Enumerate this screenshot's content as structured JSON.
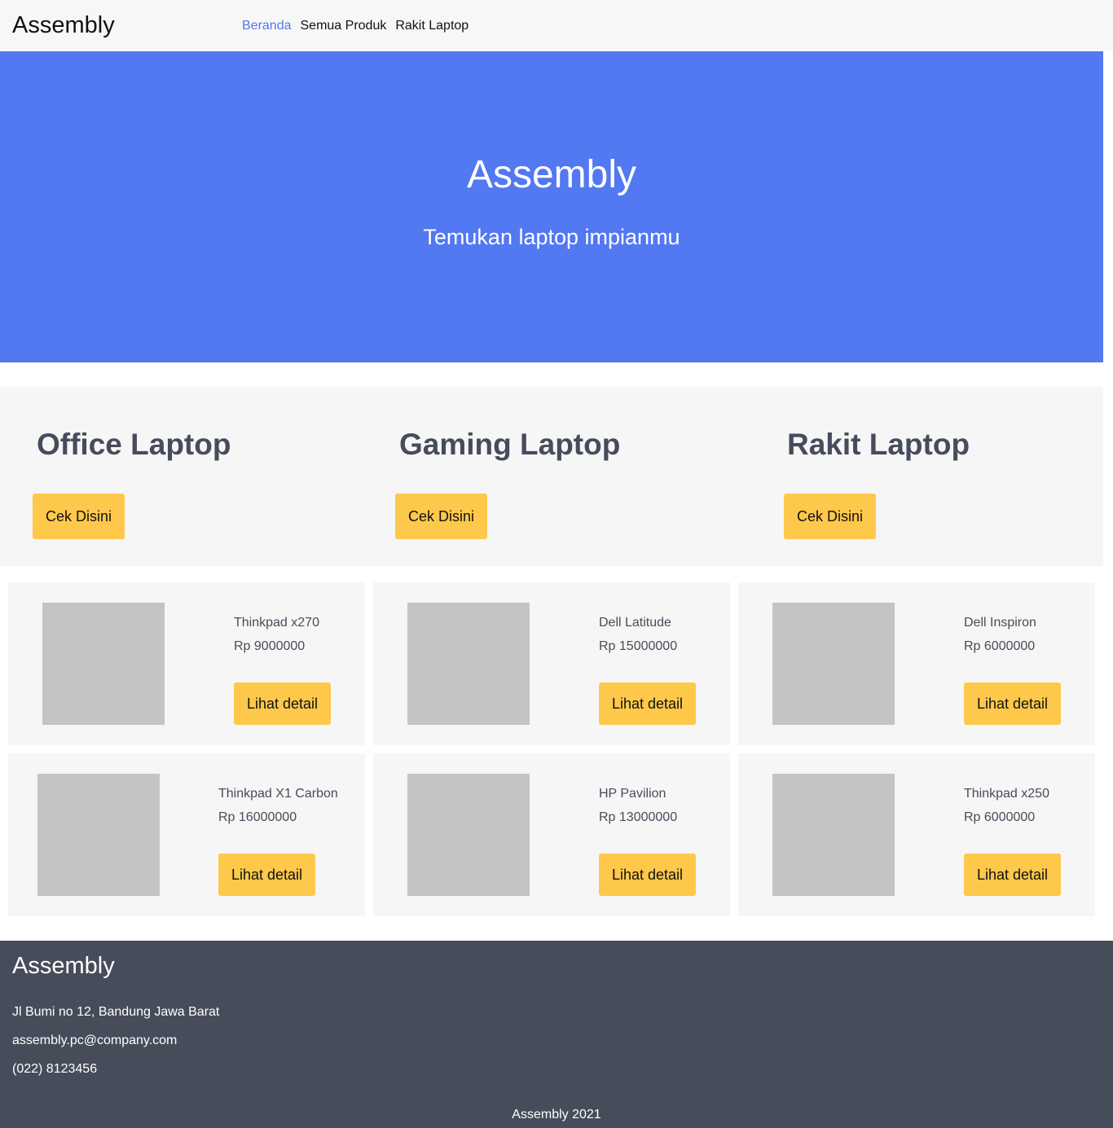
{
  "navbar": {
    "brand": "Assembly",
    "links": [
      {
        "label": "Beranda",
        "active": true
      },
      {
        "label": "Semua Produk",
        "active": false
      },
      {
        "label": "Rakit Laptop",
        "active": false
      }
    ]
  },
  "hero": {
    "title": "Assembly",
    "subtitle": "Temukan laptop impianmu"
  },
  "categories": [
    {
      "title": "Office Laptop",
      "button": "Cek Disini"
    },
    {
      "title": "Gaming Laptop",
      "button": "Cek Disini"
    },
    {
      "title": "Rakit Laptop",
      "button": "Cek Disini"
    }
  ],
  "products": [
    {
      "name": "Thinkpad x270",
      "price": "Rp 9000000",
      "button": "Lihat detail"
    },
    {
      "name": "Dell Latitude",
      "price": "Rp 15000000",
      "button": "Lihat detail"
    },
    {
      "name": "Dell Inspiron",
      "price": "Rp 6000000",
      "button": "Lihat detail"
    },
    {
      "name": "Thinkpad X1 Carbon",
      "price": "Rp 16000000",
      "button": "Lihat detail"
    },
    {
      "name": "HP Pavilion",
      "price": "Rp 13000000",
      "button": "Lihat detail"
    },
    {
      "name": "Thinkpad x250",
      "price": "Rp 6000000",
      "button": "Lihat detail"
    }
  ],
  "footer": {
    "brand": "Assembly",
    "address": "Jl Bumi no 12, Bandung Jawa Barat",
    "email": "assembly.pc@company.com",
    "phone": "(022) 8123456",
    "copyright": "Assembly 2021"
  },
  "colors": {
    "accent": "#5278f2",
    "button": "#fec84a",
    "footer": "#474c5a",
    "panel": "#f6f6f6"
  }
}
